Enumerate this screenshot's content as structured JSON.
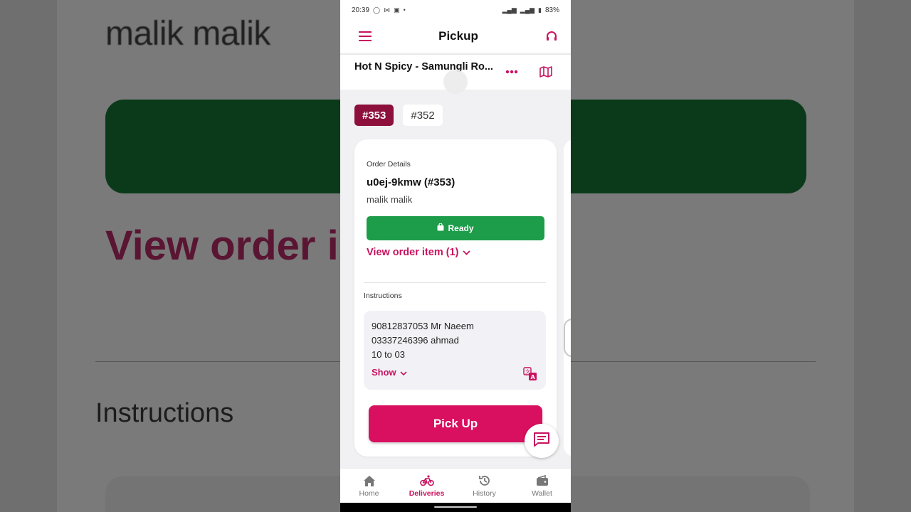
{
  "background": {
    "title": "malik malik",
    "view_order": "View order i",
    "instructions": "Instructions"
  },
  "statusbar": {
    "time": "20:39",
    "battery": "83%"
  },
  "appbar": {
    "title": "Pickup"
  },
  "restaurant": {
    "name": "Hot N Spicy - Samungli Ro..."
  },
  "orders": {
    "chips": [
      "#353",
      "#352"
    ],
    "active_index": 0
  },
  "order": {
    "details_label": "Order Details",
    "id": "u0ej-9kmw (#353)",
    "customer": "malik malik",
    "status": "Ready",
    "view_items": "View order item (1)",
    "instructions_label": "Instructions",
    "instructions_lines": [
      "90812837053 Mr Naeem",
      "03337246396 ahmad",
      "10 to 03"
    ],
    "show_label": "Show",
    "pickup_label": "Pick Up"
  },
  "nav": {
    "items": [
      {
        "label": "Home",
        "icon": "home-icon"
      },
      {
        "label": "Deliveries",
        "icon": "bike-icon"
      },
      {
        "label": "History",
        "icon": "history-icon"
      },
      {
        "label": "Wallet",
        "icon": "wallet-icon"
      }
    ],
    "active": "Deliveries"
  },
  "colors": {
    "accent": "#c8135f",
    "chip_active": "#8c0f3c",
    "ready": "#1d9c4a",
    "pickup": "#d9105f"
  }
}
